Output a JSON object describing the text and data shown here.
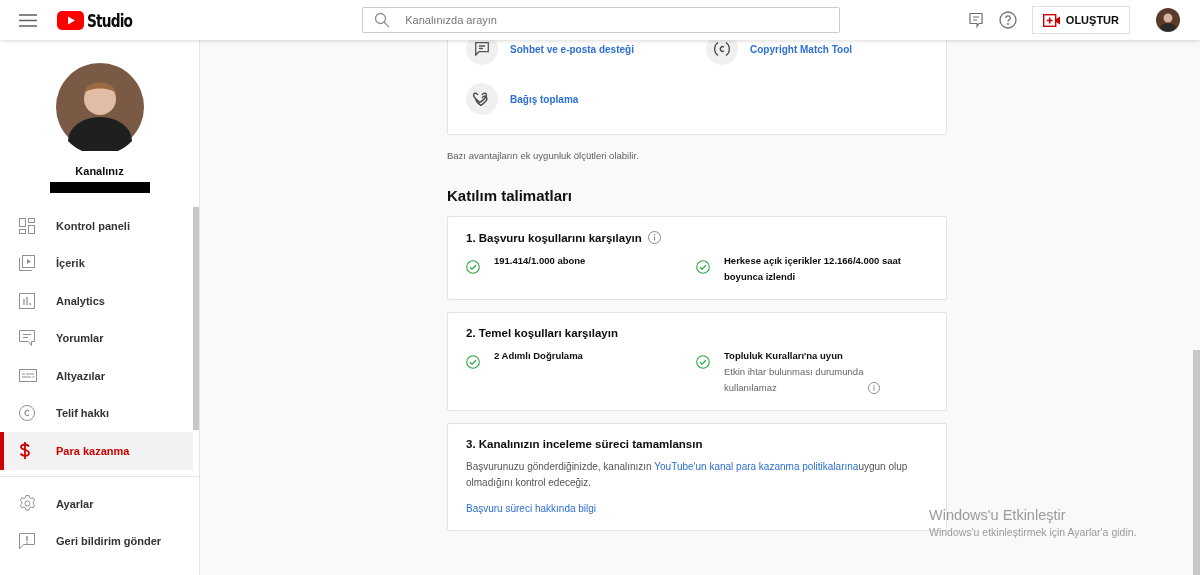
{
  "header": {
    "logo_text": "Studio",
    "search_placeholder": "Kanalınızda arayın",
    "create_label": "OLUŞTUR"
  },
  "sidebar": {
    "channel_label": "Kanalınız",
    "nav": [
      {
        "label": "Kontrol paneli",
        "kind": "dashboard",
        "selected": false
      },
      {
        "label": "İçerik",
        "kind": "content",
        "selected": false
      },
      {
        "label": "Analytics",
        "kind": "analytics",
        "selected": false
      },
      {
        "label": "Yorumlar",
        "kind": "comments",
        "selected": false
      },
      {
        "label": "Altyazılar",
        "kind": "subtitles",
        "selected": false
      },
      {
        "label": "Telif hakkı",
        "kind": "copyright",
        "selected": false
      },
      {
        "label": "Para kazanma",
        "kind": "money",
        "selected": true
      }
    ],
    "footer_nav": [
      {
        "label": "Ayarlar",
        "kind": "settings",
        "selected": false
      },
      {
        "label": "Geri bildirim gönder",
        "kind": "feedback",
        "selected": false
      }
    ]
  },
  "benefits": [
    {
      "label": "Sohbet ve e-posta desteği",
      "kind": "chat"
    },
    {
      "label": "Copyright Match Tool",
      "kind": "copyright"
    },
    {
      "label": "Bağış toplama",
      "kind": "donation"
    }
  ],
  "benefits_note": "Bazı avantajların ek uygunluk ölçütleri olabilir.",
  "section_title": "Katılım talimatları",
  "steps": [
    {
      "title": "1. Başvuru koşullarını karşılayın",
      "info": true,
      "requirements": [
        {
          "text": "191.414/1.000 abone",
          "met": true
        },
        {
          "text": "Herkese açık içerikler 12.166/4.000 saat boyunca izlendi",
          "met": true
        }
      ]
    },
    {
      "title": "2. Temel koşulları karşılayın",
      "info": false,
      "requirements": [
        {
          "text": "2 Adımlı Doğrulama",
          "met": true
        },
        {
          "text": "Topluluk Kuralları'na uyun",
          "sub": "Etkin ihtar bulunması durumunda kullanılamaz",
          "sub_info": true,
          "met": true
        }
      ]
    },
    {
      "title": "3. Kanalınızın inceleme süreci tamamlansın",
      "info": false,
      "description_before": "Başvurunuzu gönderdiğinizde, kanalınızın ",
      "description_link": "YouTube'un kanal para kazanma politikalarına",
      "description_after": "uygun olup olmadığını kontrol edeceğiz.",
      "link": "Başvuru süreci hakkında bilgi"
    }
  ],
  "os_notice": {
    "title": "Windows'u Etkinleştir",
    "subtitle": "Windows'u etkinleştirmek için Ayarlar'a gidin."
  }
}
